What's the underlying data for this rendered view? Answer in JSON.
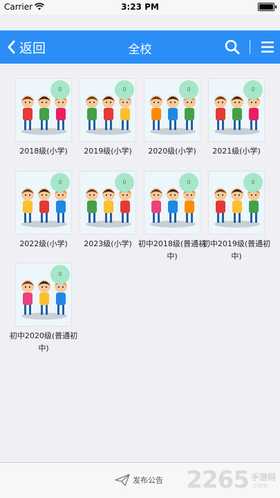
{
  "status_bar": {
    "carrier": "Carrier",
    "time": "3:23 PM"
  },
  "nav": {
    "back_label": "返回",
    "title": "全校"
  },
  "grades": [
    {
      "label": "2018级(小学)",
      "count": "0"
    },
    {
      "label": "2019级(小学)",
      "count": "0"
    },
    {
      "label": "2020级(小学)",
      "count": "0"
    },
    {
      "label": "2021级(小学)",
      "count": "0"
    },
    {
      "label": "2022级(小学)",
      "count": "0"
    },
    {
      "label": "2023级(小学)",
      "count": "0"
    },
    {
      "label": "初中2018级(普通初中)",
      "count": "0"
    },
    {
      "label": "初中2019级(普通初中)",
      "count": "0"
    },
    {
      "label": "初中2020级(普通初中)",
      "count": "0"
    }
  ],
  "bottom_bar": {
    "publish_label": "发布公告"
  },
  "watermark": {
    "number": "2265",
    "cn": "手游网",
    "suffix": ".com"
  },
  "colors": {
    "nav_bg": "#2b8ef7",
    "badge_bg": "#a7e6c8",
    "page_bg": "#efeff4"
  }
}
